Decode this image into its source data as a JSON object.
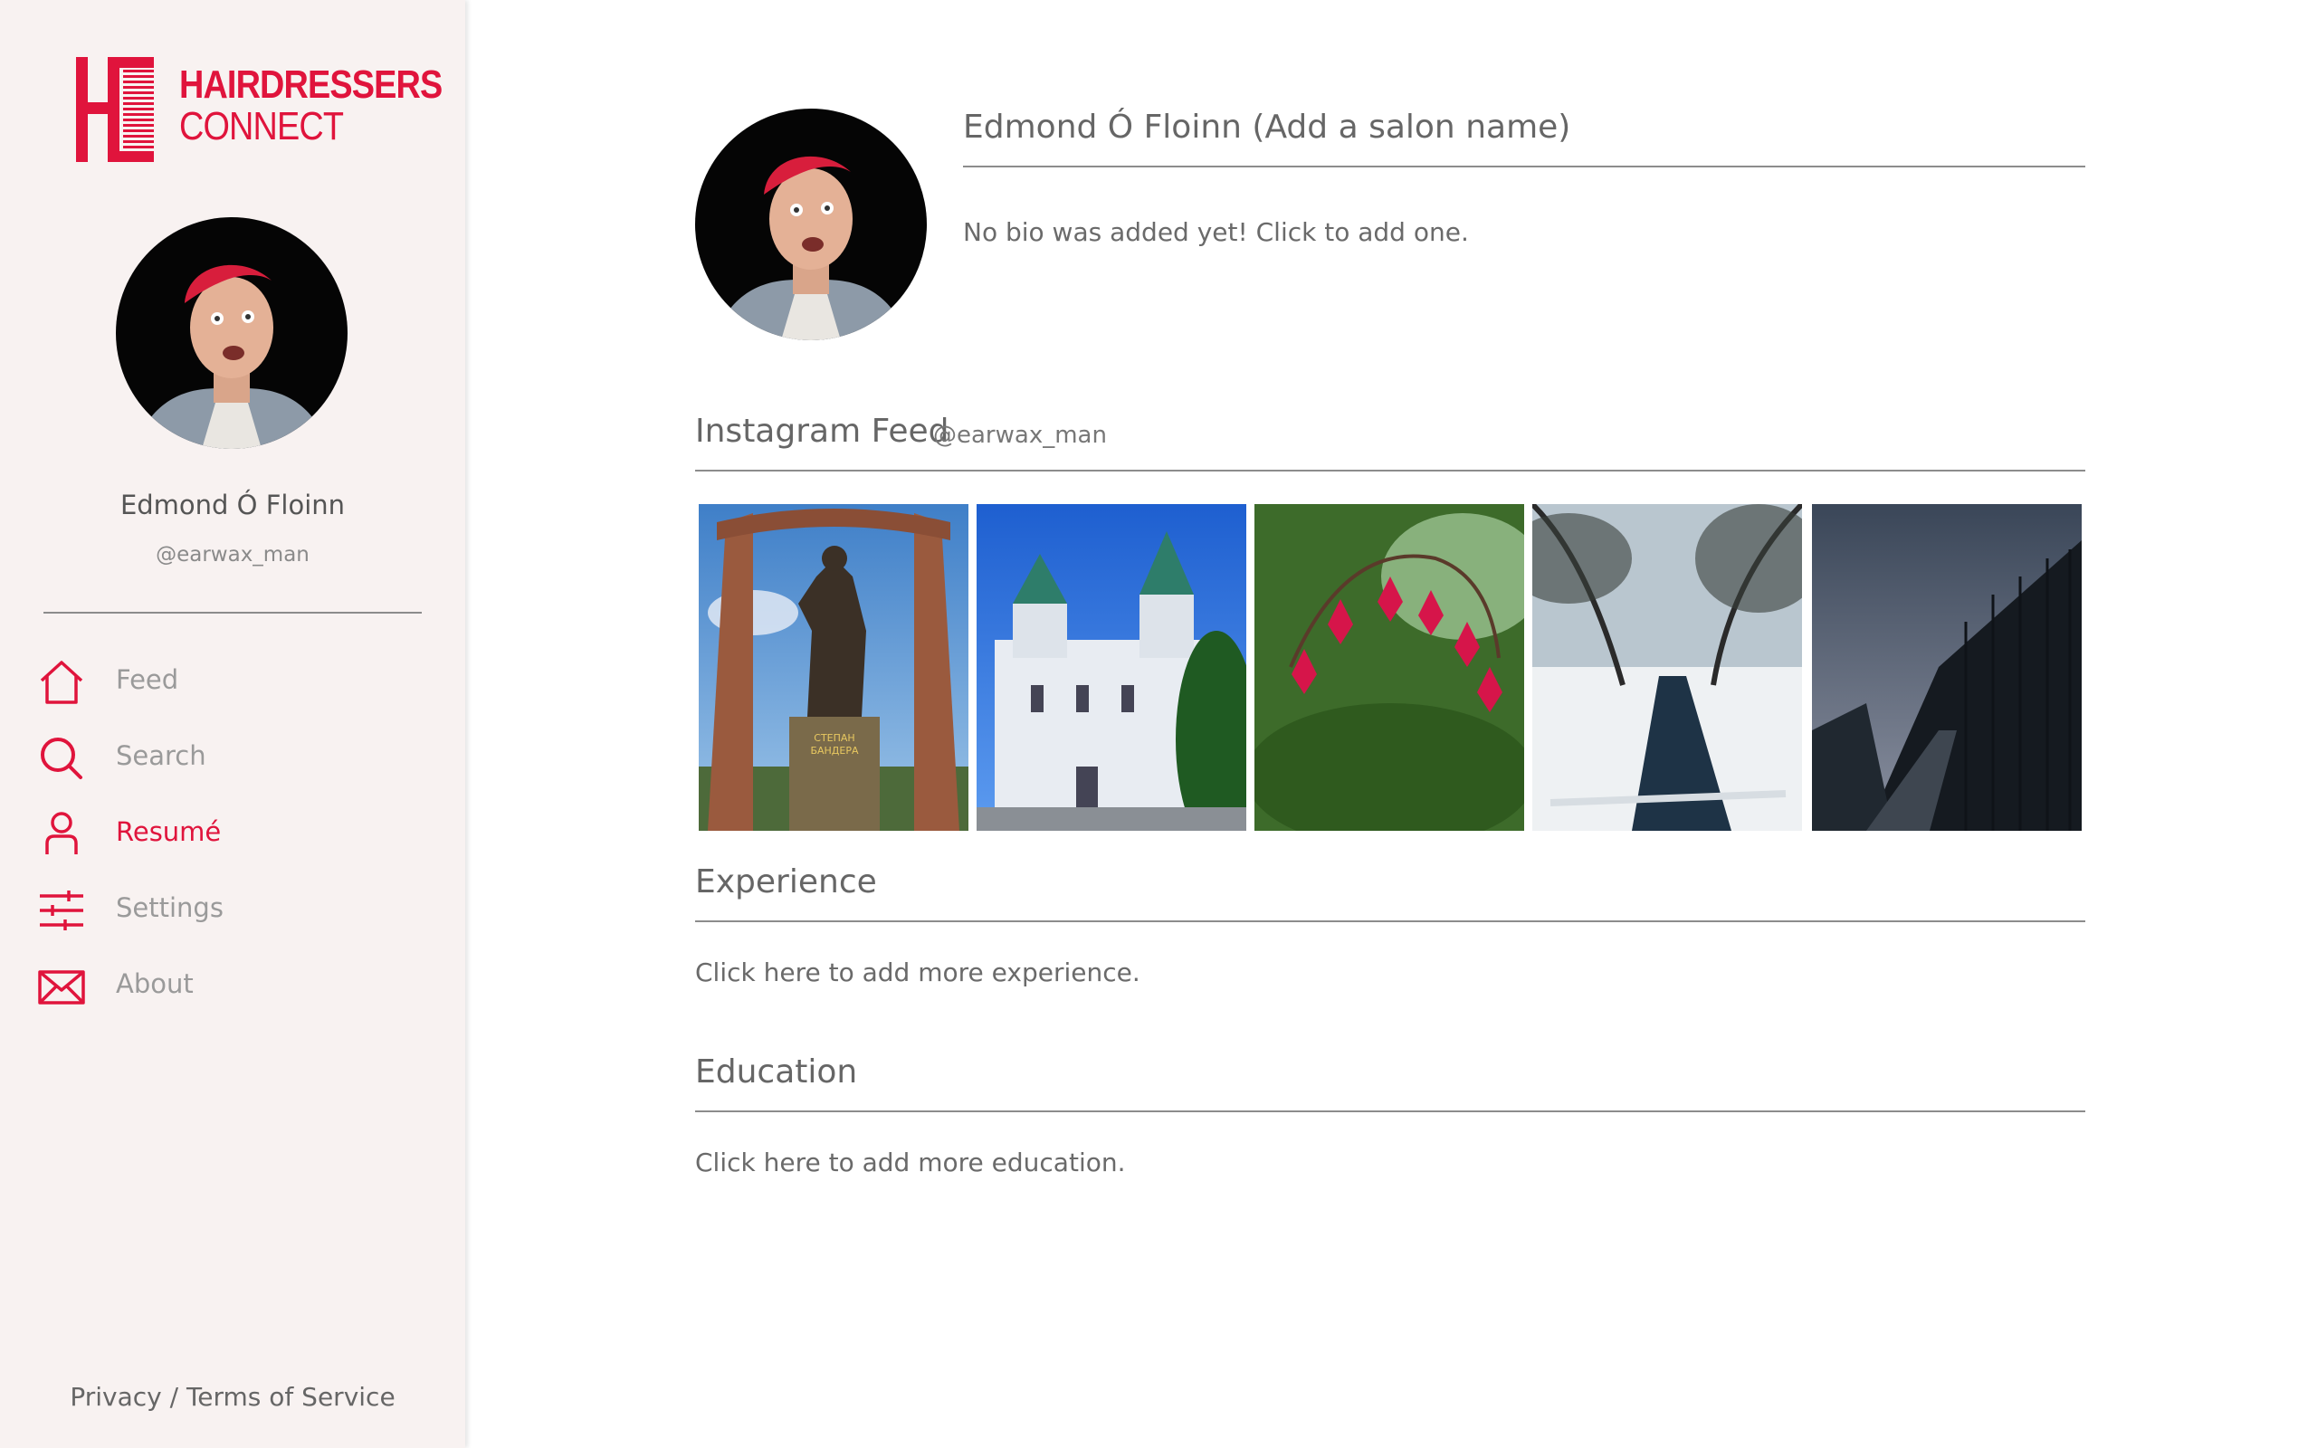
{
  "brand": {
    "line1": "HAIRDRESSERS",
    "line2": "CONNECT",
    "color": "#e0143c"
  },
  "sidebar": {
    "name": "Edmond Ó Floinn",
    "handle": "@earwax_man",
    "nav": [
      {
        "label": "Feed",
        "icon": "home-icon",
        "active": false
      },
      {
        "label": "Search",
        "icon": "search-icon",
        "active": false
      },
      {
        "label": "Resumé",
        "icon": "person-icon",
        "active": true
      },
      {
        "label": "Settings",
        "icon": "sliders-icon",
        "active": false
      },
      {
        "label": "About",
        "icon": "envelope-icon",
        "active": false
      }
    ],
    "footer": "Privacy / Terms of Service"
  },
  "profile": {
    "title": "Edmond Ó Floinn (Add a salon name)",
    "bio": "No bio was added yet! Click to add one."
  },
  "instagram": {
    "title": "Instagram Feed",
    "handle": "@earwax_man",
    "photos": [
      {
        "subject": "statue-monument",
        "caption": "СТЕПАН\nБАНДЕРА"
      },
      {
        "subject": "baroque-church"
      },
      {
        "subject": "bleeding-heart-flowers"
      },
      {
        "subject": "snowy-canal"
      },
      {
        "subject": "dark-forest-path"
      }
    ]
  },
  "experience": {
    "title": "Experience",
    "add": "Click here to add more experience."
  },
  "education": {
    "title": "Education",
    "add": "Click here to add more education."
  },
  "colors": {
    "accent": "#e0143c",
    "sidebar_bg": "#f8f2f1",
    "text": "#5a5a5a",
    "divider": "#8c8c8c"
  }
}
